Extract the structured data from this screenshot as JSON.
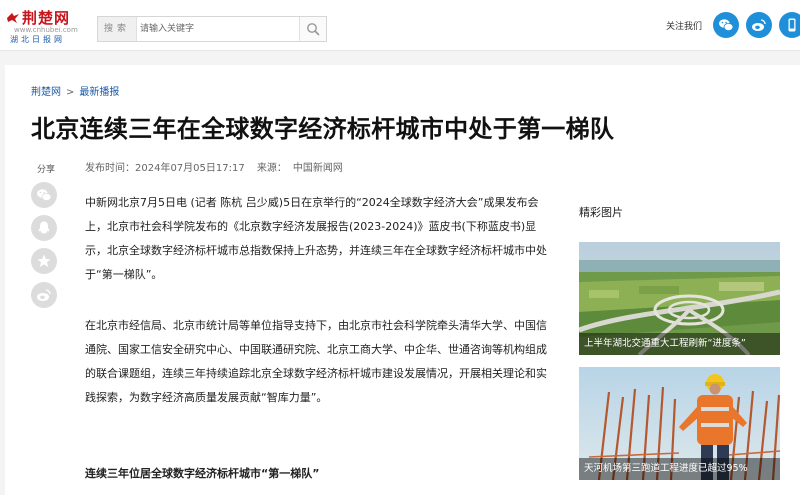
{
  "site": {
    "logo_text": "荆楚网",
    "logo_url": "www.cnhubei.com",
    "logo_subtitle": "湖北日报网",
    "brand_color": "#c8161d"
  },
  "search": {
    "label": "搜索",
    "placeholder": "请输入关键字",
    "value": ""
  },
  "header": {
    "follow_label": "关注我们",
    "social_icons": [
      "wechat-icon",
      "weibo-icon",
      "phone-icon"
    ],
    "social_color": "#1e8fd8"
  },
  "breadcrumb": {
    "items": [
      "荆楚网",
      "最新播报"
    ],
    "separator": ">"
  },
  "article": {
    "title": "北京连续三年在全球数字经济标杆城市中处于第一梯队",
    "share_label": "分享",
    "publish_label": "发布时间：",
    "publish_time": "2024年07月05日17:17",
    "source_label": "来源：",
    "source": "中国新闻网",
    "share_icons": [
      "wechat-icon",
      "qq-icon",
      "qzone-star-icon",
      "weibo-icon"
    ],
    "paragraphs": [
      "中新网北京7月5日电 (记者 陈杭 吕少威)5日在京举行的“2024全球数字经济大会”成果发布会上，北京市社会科学院发布的《北京数字经济发展报告(2023-2024)》蓝皮书(下称蓝皮书)显示，北京全球数字经济标杆城市总指数保持上升态势，并连续三年在全球数字经济标杆城市中处于“第一梯队”。",
      "在北京市经信局、北京市统计局等单位指导支持下，由北京市社会科学院牵头清华大学、中国信通院、国家工信安全研究中心、中国联通研究院、北京工商大学、中企华、世通咨询等机构组成的联合课题组，连续三年持续追踪北京全球数字经济标杆城市建设发展情况，开展相关理论和实践探索，为数字经济高质量发展贡献“智库力量”。"
    ],
    "subheading": "连续三年位居全球数字经济标杆城市“第一梯队”"
  },
  "sidebar": {
    "title": "精彩图片",
    "items": [
      {
        "caption": "上半年湖北交通重大工程刷新“进度条”"
      },
      {
        "caption": "天河机场第三跑道工程进度已超过95%"
      }
    ]
  }
}
